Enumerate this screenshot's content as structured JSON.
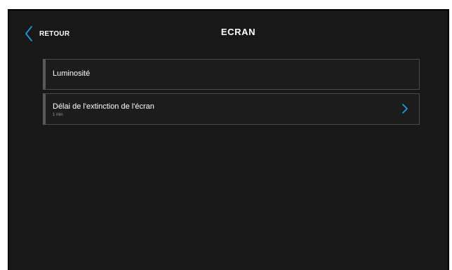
{
  "header": {
    "back_label": "RETOUR",
    "title": "ECRAN"
  },
  "settings": {
    "items": [
      {
        "label": "Luminosité"
      },
      {
        "label": "Délai de l'extinction de l'écran",
        "value": "1 min"
      }
    ]
  },
  "colors": {
    "accent": "#1ea0e6",
    "background": "#181818",
    "item_border": "#4a4a4a",
    "item_left_bar": "#5a5a5a"
  },
  "icons": {
    "back": "chevron-left-icon",
    "item_arrow": "chevron-right-icon"
  }
}
